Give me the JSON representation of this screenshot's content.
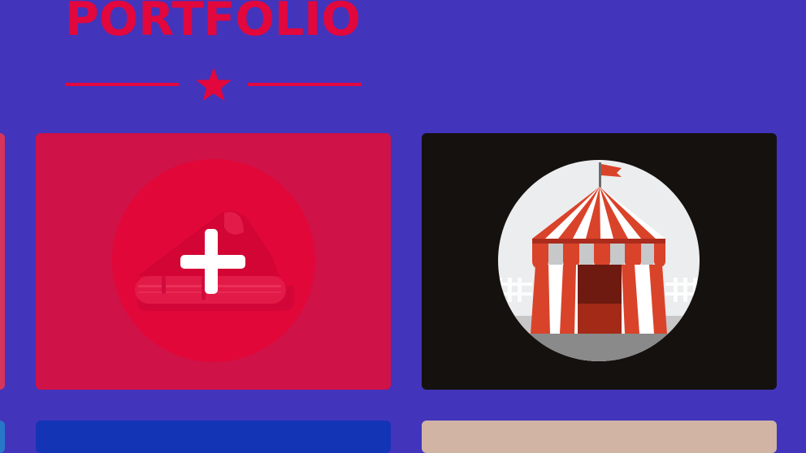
{
  "section": {
    "title": "PORTFOLIO"
  },
  "divider": {
    "icon": "star-icon"
  },
  "cards": [
    {
      "name": "portfolio-card-partial-left",
      "icon": ""
    },
    {
      "name": "portfolio-card-add",
      "icon": "plus-icon"
    },
    {
      "name": "portfolio-card-circus",
      "icon": "circus-tent-icon"
    },
    {
      "name": "portfolio-card-partial-left-bottom",
      "icon": ""
    },
    {
      "name": "portfolio-card-blue",
      "icon": ""
    },
    {
      "name": "portfolio-card-beige",
      "icon": ""
    }
  ],
  "colors": {
    "background": "#4334bc",
    "accent": "#e2073d",
    "card_red": "#cf1248",
    "card_dark": "#15110f",
    "card_blue": "#1335b5",
    "card_beige": "#d1b4a4"
  }
}
